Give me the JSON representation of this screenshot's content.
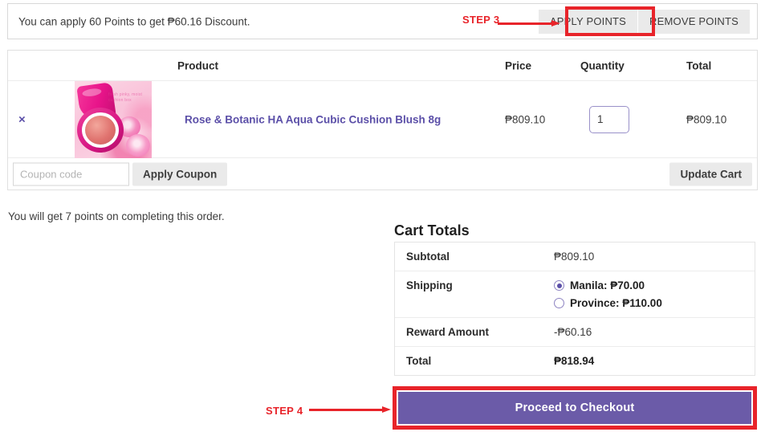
{
  "points_bar": {
    "message": "You can apply 60 Points to get ₱60.16 Discount.",
    "apply_label": "APPLY POINTS",
    "remove_label": "REMOVE POINTS"
  },
  "annotations": {
    "step3": "STEP 3",
    "step4": "STEP 4",
    "highlight_color": "#e8242a"
  },
  "cart": {
    "headers": {
      "product": "Product",
      "price": "Price",
      "quantity": "Quantity",
      "total": "Total"
    },
    "remove_icon": "×",
    "item": {
      "name": "Rose & Botanic HA Aqua Cubic Cushion Blush 8g",
      "thumb_caption": "fresh pinky, moist cushion box",
      "price": "₱809.10",
      "quantity": "1",
      "line_total": "₱809.10"
    },
    "coupon_placeholder": "Coupon code",
    "coupon_value": "",
    "apply_coupon_label": "Apply Coupon",
    "update_cart_label": "Update Cart"
  },
  "earn_note": "You will get 7 points on completing this order.",
  "totals": {
    "title": "Cart Totals",
    "rows": [
      {
        "label": "Subtotal",
        "value": "₱809.10"
      },
      {
        "label": "Reward Amount",
        "value": "-₱60.16"
      },
      {
        "label": "Total",
        "value": "₱818.94"
      }
    ],
    "shipping": {
      "label": "Shipping",
      "options": [
        {
          "label": "Manila: ₱70.00",
          "selected": true
        },
        {
          "label": "Province: ₱110.00",
          "selected": false
        }
      ]
    }
  },
  "checkout": {
    "label": "Proceed to Checkout",
    "color": "#6b5ba8"
  }
}
